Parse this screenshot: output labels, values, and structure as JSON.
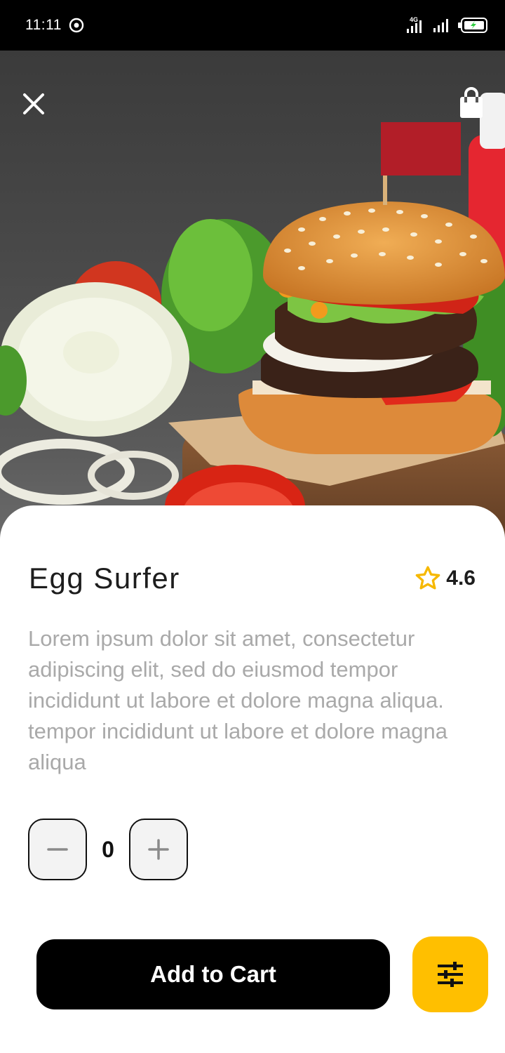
{
  "status_bar": {
    "time": "11:11",
    "network_label": "4G"
  },
  "hero": {
    "close_icon": "close-icon",
    "bag_icon": "shopping-bag-icon"
  },
  "product": {
    "name": "Egg Surfer",
    "rating": "4.6",
    "description": "Lorem ipsum dolor sit amet, consectetur adipiscing elit, sed do eiusmod tempor incididunt ut labore et dolore magna aliqua. tempor incididunt ut labore et dolore magna aliqua"
  },
  "quantity": {
    "value": "0"
  },
  "actions": {
    "add_to_cart_label": "Add to Cart",
    "filter_icon": "sliders-icon"
  },
  "colors": {
    "accent": "#FFBF00",
    "primary_button": "#000000",
    "description_text": "#A9A9A9"
  }
}
